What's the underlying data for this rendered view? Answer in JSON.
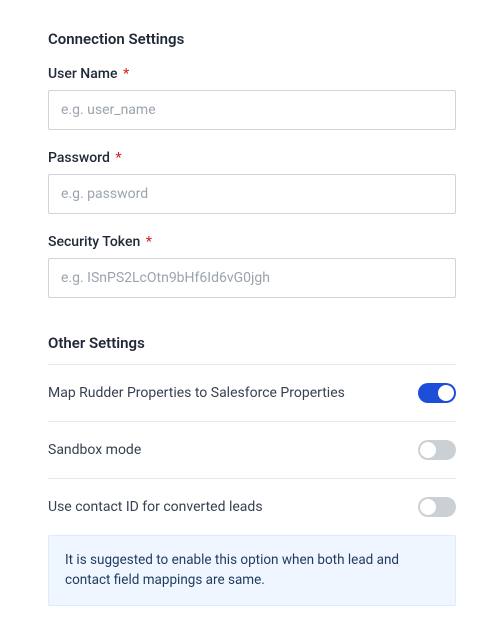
{
  "connection": {
    "title": "Connection Settings",
    "username": {
      "label": "User Name",
      "required": "*",
      "placeholder": "e.g. user_name",
      "value": ""
    },
    "password": {
      "label": "Password",
      "required": "*",
      "placeholder": "e.g. password",
      "value": ""
    },
    "security_token": {
      "label": "Security Token",
      "required": "*",
      "placeholder": "e.g. ISnPS2LcOtn9bHf6Id6vG0jgh",
      "value": ""
    }
  },
  "other": {
    "title": "Other Settings",
    "map_properties": {
      "label": "Map Rudder Properties to Salesforce Properties",
      "enabled": true
    },
    "sandbox": {
      "label": "Sandbox mode",
      "enabled": false
    },
    "contact_id": {
      "label": "Use contact ID for converted leads",
      "enabled": false
    },
    "info_text": "It is suggested to enable this option when both lead and contact field mappings are same."
  }
}
